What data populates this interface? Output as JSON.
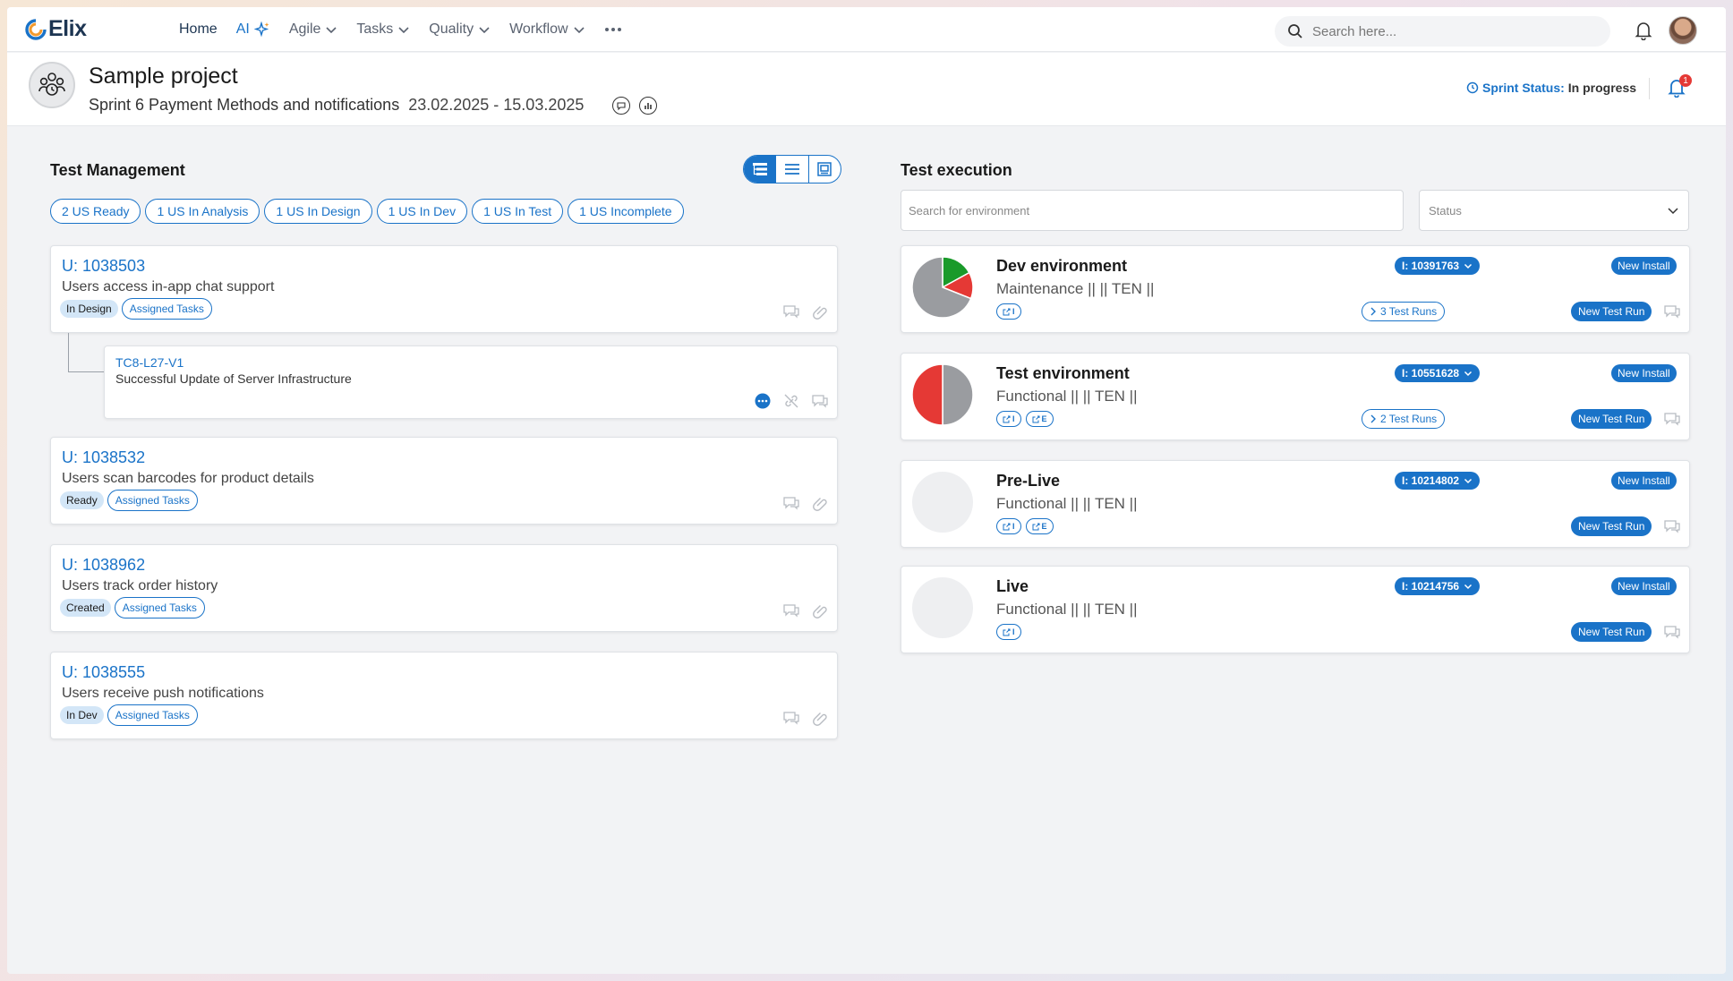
{
  "app": {
    "name": "Elix"
  },
  "nav": {
    "items": [
      {
        "label": "Home",
        "active": true
      },
      {
        "label": "AI"
      },
      {
        "label": "Agile",
        "dropdown": true
      },
      {
        "label": "Tasks",
        "dropdown": true
      },
      {
        "label": "Quality",
        "dropdown": true
      },
      {
        "label": "Workflow",
        "dropdown": true
      }
    ],
    "more_icon": "ellipsis-icon",
    "search_placeholder": "Search here..."
  },
  "project": {
    "title": "Sample project",
    "sprint": "Sprint 6 Payment Methods and notifications",
    "dates": "23.02.2025 - 15.03.2025",
    "status_label": "Sprint Status:",
    "status_value": "In progress",
    "notification_count": "1"
  },
  "test_management": {
    "title": "Test Management",
    "filters": [
      "2 US Ready",
      "1 US In Analysis",
      "1 US In Design",
      "1 US In Dev",
      "1 US In Test",
      "1 US Incomplete"
    ],
    "stories": [
      {
        "id": "U: 1038503",
        "desc": "Users access in-app chat support",
        "status": "In Design",
        "assigned": "Assigned Tasks"
      },
      {
        "id": "U: 1038532",
        "desc": "Users scan barcodes for product details",
        "status": "Ready",
        "assigned": "Assigned Tasks"
      },
      {
        "id": "U: 1038962",
        "desc": "Users track order history",
        "status": "Created",
        "assigned": "Assigned Tasks"
      },
      {
        "id": "U: 1038555",
        "desc": "Users receive push notifications",
        "status": "In Dev",
        "assigned": "Assigned Tasks"
      }
    ],
    "test_case": {
      "id": "TC8-L27-V1",
      "desc": "Successful Update of Server Infrastructure"
    }
  },
  "test_execution": {
    "title": "Test execution",
    "search_placeholder": "Search for environment",
    "status_placeholder": "Status",
    "environments": [
      {
        "name": "Dev environment",
        "sub": "Maintenance || || TEN ||",
        "install_id": "I: 10391763",
        "new_install": "New Install",
        "test_runs": "3 Test Runs",
        "new_run": "New Test Run",
        "badges": [
          "I"
        ],
        "pie": [
          {
            "value": 0.17,
            "color": "#1a9a2a"
          },
          {
            "value": 0.14,
            "color": "#e53935"
          },
          {
            "value": 0.69,
            "color": "#9a9ca0"
          }
        ]
      },
      {
        "name": "Test environment",
        "sub": "Functional || || TEN ||",
        "install_id": "I: 10551628",
        "new_install": "New Install",
        "test_runs": "2 Test Runs",
        "new_run": "New Test Run",
        "badges": [
          "I",
          "E"
        ],
        "pie": [
          {
            "value": 0.5,
            "color": "#9a9ca0"
          },
          {
            "value": 0.5,
            "color": "#e53935"
          }
        ]
      },
      {
        "name": "Pre-Live",
        "sub": "Functional || || TEN ||",
        "install_id": "I: 10214802",
        "new_install": "New Install",
        "test_runs": "",
        "new_run": "New Test Run",
        "badges": [
          "I",
          "E"
        ],
        "pie": []
      },
      {
        "name": "Live",
        "sub": "Functional || || TEN ||",
        "install_id": "I: 10214756",
        "new_install": "New Install",
        "test_runs": "",
        "new_run": "New Test Run",
        "badges": [
          "I"
        ],
        "pie": []
      }
    ]
  },
  "colors": {
    "accent": "#1a73c8",
    "brand_dark": "#1d3552",
    "danger": "#e53935",
    "success": "#1a9a2a"
  }
}
